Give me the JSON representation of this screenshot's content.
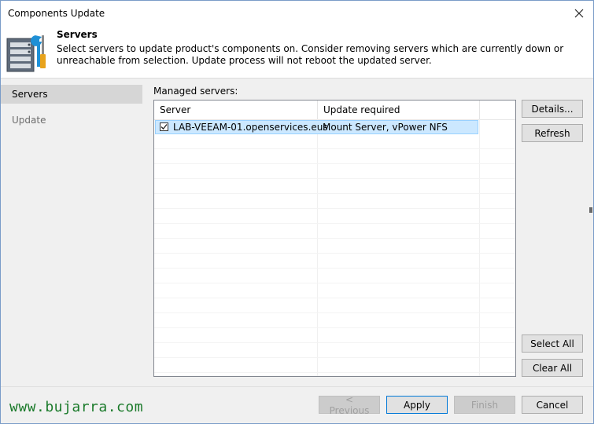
{
  "window": {
    "title": "Components Update"
  },
  "header": {
    "title": "Servers",
    "description": "Select servers to update product's components on. Consider removing servers which are currently down or unreachable from selection. Update process will not reboot the updated server."
  },
  "sidebar": {
    "items": [
      {
        "label": "Servers",
        "active": true
      },
      {
        "label": "Update",
        "active": false
      }
    ]
  },
  "main": {
    "label": "Managed servers:",
    "columns": [
      "Server",
      "Update required"
    ],
    "rows": [
      {
        "checked": true,
        "server": "LAB-VEEAM-01.openservices.eus",
        "update": "Mount Server, vPower NFS"
      }
    ]
  },
  "side_buttons": {
    "details": "Details...",
    "refresh": "Refresh",
    "select_all": "Select All",
    "clear_all": "Clear All"
  },
  "footer": {
    "previous": "< Previous",
    "apply": "Apply",
    "finish": "Finish",
    "cancel": "Cancel"
  },
  "watermark": "www.bujarra.com",
  "colors": {
    "selection": "#cce8ff",
    "accent": "#0078d7",
    "watermark": "#1a7a2a"
  }
}
